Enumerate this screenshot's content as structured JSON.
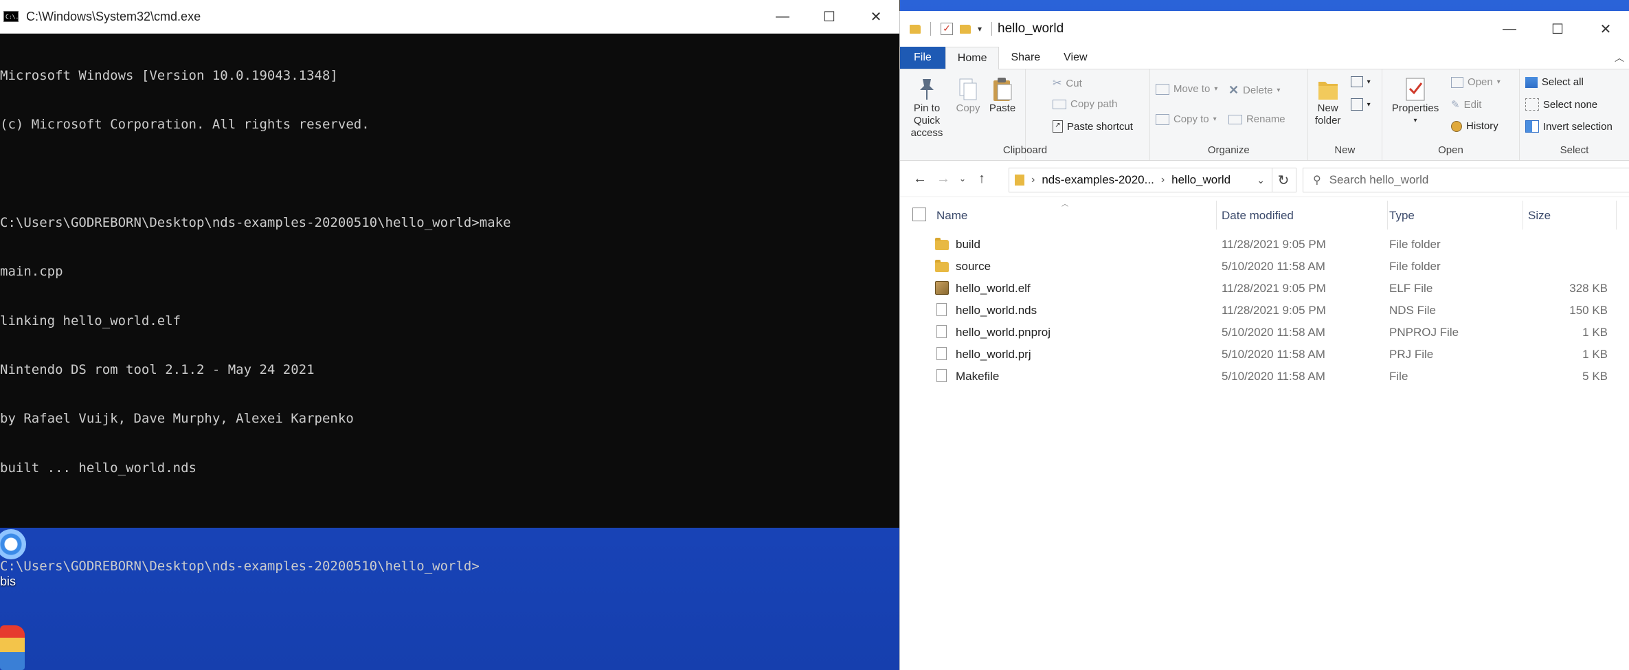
{
  "desktop": {
    "icon_label": "bis"
  },
  "cmd": {
    "title": "C:\\Windows\\System32\\cmd.exe",
    "icon_text": "C:\\.",
    "lines": [
      "Microsoft Windows [Version 10.0.19043.1348]",
      "(c) Microsoft Corporation. All rights reserved.",
      "",
      "C:\\Users\\GODREBORN\\Desktop\\nds-examples-20200510\\hello_world>make",
      "main.cpp",
      "linking hello_world.elf",
      "Nintendo DS rom tool 2.1.2 - May 24 2021",
      "by Rafael Vuijk, Dave Murphy, Alexei Karpenko",
      "built ... hello_world.nds",
      "",
      "C:\\Users\\GODREBORN\\Desktop\\nds-examples-20200510\\hello_world>"
    ],
    "controls": {
      "minimize": "—",
      "maximize": "☐",
      "close": "✕"
    }
  },
  "explorer": {
    "title": "hello_world",
    "controls": {
      "minimize": "—",
      "maximize": "☐",
      "close": "✕"
    },
    "tabs": {
      "file": "File",
      "home": "Home",
      "share": "Share",
      "view": "View"
    },
    "ribbon": {
      "clipboard": {
        "label": "Clipboard",
        "pin": "Pin to Quick access",
        "copy": "Copy",
        "paste": "Paste",
        "cut": "Cut",
        "copy_path": "Copy path",
        "paste_shortcut": "Paste shortcut"
      },
      "organize": {
        "label": "Organize",
        "move_to": "Move to",
        "copy_to": "Copy to",
        "delete": "Delete",
        "rename": "Rename"
      },
      "new": {
        "label": "New",
        "new_folder_line1": "New",
        "new_folder_line2": "folder"
      },
      "open": {
        "label": "Open",
        "properties": "Properties",
        "open": "Open",
        "edit": "Edit",
        "history": "History"
      },
      "select": {
        "label": "Select",
        "select_all": "Select all",
        "select_none": "Select none",
        "invert": "Invert selection"
      }
    },
    "address": {
      "crumbs": [
        "nds-examples-2020...",
        "hello_world"
      ],
      "search_placeholder": "Search hello_world"
    },
    "columns": {
      "name": "Name",
      "date": "Date modified",
      "type": "Type",
      "size": "Size"
    },
    "files": [
      {
        "name": "build",
        "date": "11/28/2021 9:05 PM",
        "type": "File folder",
        "size": "",
        "icon": "folder-icon"
      },
      {
        "name": "source",
        "date": "5/10/2020 11:58 AM",
        "type": "File folder",
        "size": "",
        "icon": "folder-icon"
      },
      {
        "name": "hello_world.elf",
        "date": "11/28/2021 9:05 PM",
        "type": "ELF File",
        "size": "328 KB",
        "icon": "elf-file-icon"
      },
      {
        "name": "hello_world.nds",
        "date": "11/28/2021 9:05 PM",
        "type": "NDS File",
        "size": "150 KB",
        "icon": "file-icon"
      },
      {
        "name": "hello_world.pnproj",
        "date": "5/10/2020 11:58 AM",
        "type": "PNPROJ File",
        "size": "1 KB",
        "icon": "file-icon"
      },
      {
        "name": "hello_world.prj",
        "date": "5/10/2020 11:58 AM",
        "type": "PRJ File",
        "size": "1 KB",
        "icon": "file-icon"
      },
      {
        "name": "Makefile",
        "date": "5/10/2020 11:58 AM",
        "type": "File",
        "size": "5 KB",
        "icon": "file-icon"
      }
    ]
  }
}
